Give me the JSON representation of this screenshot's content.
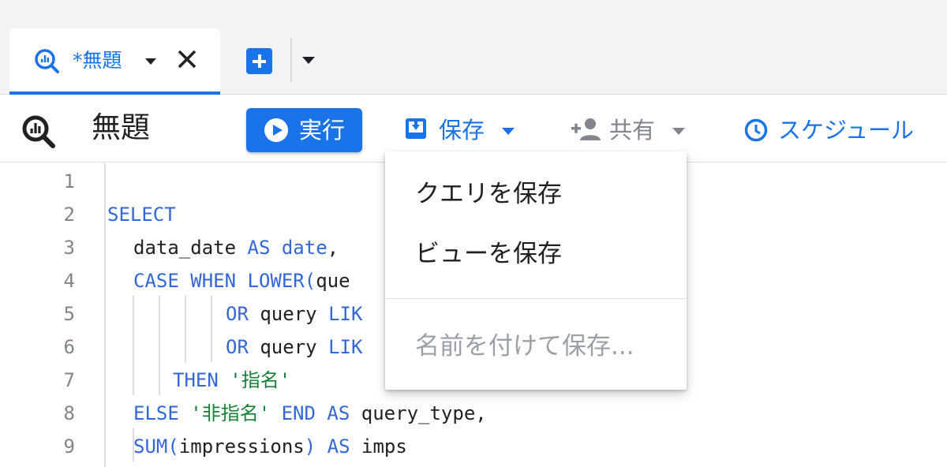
{
  "tabs": {
    "active": {
      "title": "*無題",
      "icon": "query-icon"
    },
    "new_tab_icon": "plus-icon",
    "menu_icon": "caret-down-icon"
  },
  "toolbar": {
    "query_icon": "query-icon",
    "title": "無題",
    "run_label": "実行",
    "save_label": "保存",
    "share_label": "共有",
    "schedule_label": "スケジュール"
  },
  "save_menu": {
    "items": [
      {
        "label": "クエリを保存",
        "enabled": true
      },
      {
        "label": "ビューを保存",
        "enabled": true
      },
      {
        "label": "名前を付けて保存...",
        "enabled": false
      }
    ]
  },
  "editor": {
    "lines": [
      {
        "num": "1"
      },
      {
        "num": "2"
      },
      {
        "num": "3"
      },
      {
        "num": "4"
      },
      {
        "num": "5"
      },
      {
        "num": "6"
      },
      {
        "num": "7"
      },
      {
        "num": "8"
      },
      {
        "num": "9"
      }
    ],
    "tokens": {
      "l2_kw1": "SELECT",
      "l3_id1": "data_date ",
      "l3_kw1": "AS",
      "l3_id2": " ",
      "l3_kw2": "date",
      "l3_id3": ",",
      "l4_kw1": "CASE",
      "l4_id1": " ",
      "l4_kw2": "WHEN",
      "l4_id2": " ",
      "l4_kw3": "LOWER(",
      "l4_id3": "que",
      "l5_kw1": "OR",
      "l5_id1": " query ",
      "l5_kw2": "LIK",
      "l6_kw1": "OR",
      "l6_id1": " query ",
      "l6_kw2": "LIK",
      "l7_kw1": "THEN",
      "l7_id1": " ",
      "l7_str1": "'指名'",
      "l8_kw1": "ELSE",
      "l8_id1": " ",
      "l8_str1": "'非指名'",
      "l8_id2": " ",
      "l8_kw2": "END",
      "l8_id3": " ",
      "l8_kw3": "AS",
      "l8_id4": " query_type,",
      "l9_kw1": "SUM(",
      "l9_id1": "impressions",
      "l9_kw2": ")",
      "l9_id2": " ",
      "l9_kw3": "AS",
      "l9_id3": " imps"
    }
  },
  "colors": {
    "accent": "#1a73e8",
    "keyword": "#3367d6",
    "string": "#188038",
    "disabled": "#9aa0a6",
    "line_number": "#80868b"
  }
}
